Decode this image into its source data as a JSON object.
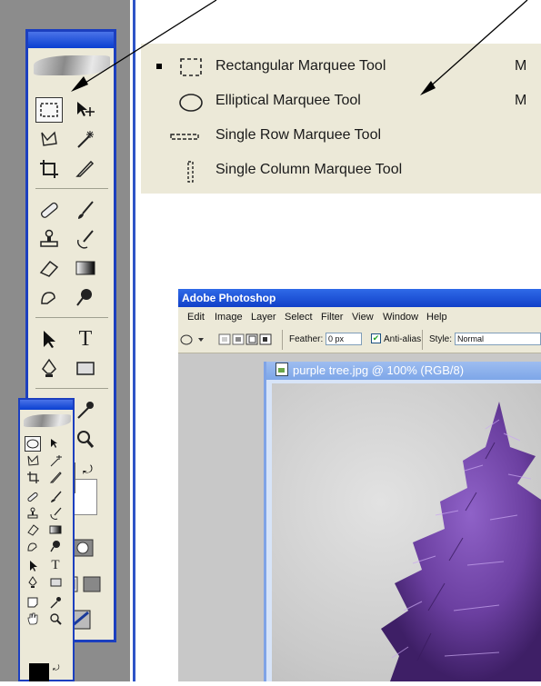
{
  "flyout": {
    "items": [
      {
        "label": "Rectangular Marquee Tool",
        "shortcut": "M",
        "selected": true,
        "icon": "rectangular-marquee-icon"
      },
      {
        "label": "Elliptical Marquee Tool",
        "shortcut": "M",
        "selected": false,
        "icon": "elliptical-marquee-icon"
      },
      {
        "label": "Single Row Marquee Tool",
        "shortcut": "",
        "selected": false,
        "icon": "single-row-marquee-icon"
      },
      {
        "label": "Single Column Marquee Tool",
        "shortcut": "",
        "selected": false,
        "icon": "single-column-marquee-icon"
      }
    ]
  },
  "photoshop": {
    "title": "Adobe Photoshop",
    "menu": [
      "Edit",
      "Image",
      "Layer",
      "Select",
      "Filter",
      "View",
      "Window",
      "Help"
    ],
    "options": {
      "feather_label": "Feather:",
      "feather_value": "0 px",
      "antialias_label": "Anti-alias",
      "antialias_checked": true,
      "style_label": "Style:",
      "style_value": "Normal"
    },
    "document": {
      "title": "purple tree.jpg @ 100% (RGB/8)"
    }
  },
  "colors": {
    "menu_bg": "#ece9d8",
    "title_blue": "#0a3fd1",
    "tree_purple": "#6b3fa0"
  }
}
